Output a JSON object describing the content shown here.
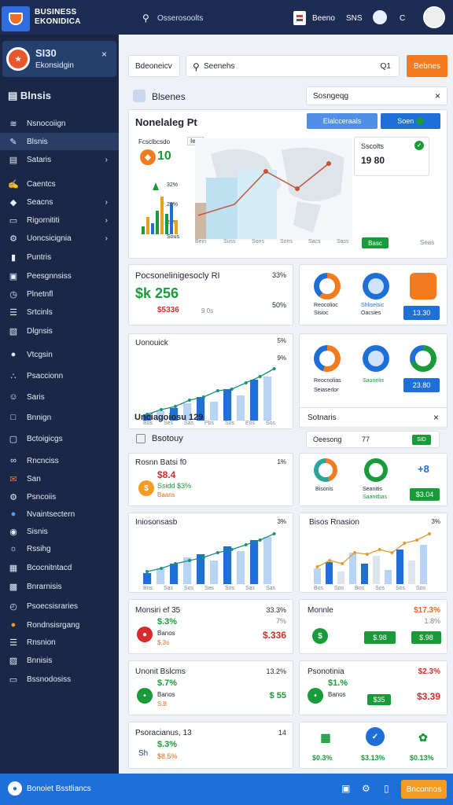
{
  "topbar": {
    "brand_line1": "BUSINESS",
    "brand_line2": "EKONIDICA",
    "search_text": "Osserosoolts",
    "button1": "Beeno",
    "button2": "SNS",
    "icon_c": "C"
  },
  "sidebar": {
    "card_title": "SI30",
    "card_sub": "Ekonsidgin",
    "heading": "Blnsis",
    "items": [
      {
        "label": "Nsnocoiign",
        "icon": "chart-icon"
      },
      {
        "label": "Blsnis",
        "icon": "edit-icon"
      },
      {
        "label": "Sataris",
        "icon": "doc-icon"
      },
      {
        "label": "Caentcs",
        "icon": "pen-icon"
      },
      {
        "label": "Seacns",
        "icon": "shield-icon"
      },
      {
        "label": "Rigornititi",
        "icon": "monitor-icon"
      },
      {
        "label": "Uoncsicignia",
        "icon": "gear-icon"
      },
      {
        "label": "Puntris",
        "icon": "bar-icon"
      },
      {
        "label": "Peesgnnsiss",
        "icon": "image-icon"
      },
      {
        "label": "Plnetnfl",
        "icon": "clock-icon"
      },
      {
        "label": "Srtcinls",
        "icon": "list-icon"
      },
      {
        "label": "Dlgnsis",
        "icon": "doc2-icon"
      },
      {
        "label": "Vtcgsin",
        "icon": "globe-icon"
      },
      {
        "label": "Psaccionn",
        "icon": "stats-icon"
      },
      {
        "label": "Saris",
        "icon": "people-icon"
      },
      {
        "label": "Bnnign",
        "icon": "square-icon"
      },
      {
        "label": "Bctoigicgs",
        "icon": "box-icon"
      },
      {
        "label": "Rncnciss",
        "icon": "link-icon"
      },
      {
        "label": "San",
        "icon": "mail-icon"
      },
      {
        "label": "Psncoiis",
        "icon": "cog-icon"
      },
      {
        "label": "Nvaintsectern",
        "icon": "twitter-icon"
      },
      {
        "label": "Sisnis",
        "icon": "circle-icon"
      },
      {
        "label": "Rssihg",
        "icon": "rss-icon"
      },
      {
        "label": "Bcocnitntacd",
        "icon": "table-icon"
      },
      {
        "label": "Bnrarnisis",
        "icon": "grid-icon"
      },
      {
        "label": "Psoecsisraries",
        "icon": "clock2-icon"
      },
      {
        "label": "Rondnsisrgang",
        "icon": "orange-icon"
      },
      {
        "label": "Rnsnion",
        "icon": "stack-icon"
      },
      {
        "label": "Bnnisis",
        "icon": "sheet-icon"
      },
      {
        "label": "Bssnodosiss",
        "icon": "monitor2-icon"
      }
    ]
  },
  "toolbar": {
    "dropdown": "Bdeoneicv",
    "search_placeholder": "Seenehs",
    "search_icon_text": "Q1",
    "action": "Bebnes"
  },
  "section1": {
    "title": "Blsenes",
    "filter": "Sosngeqg"
  },
  "map_card": {
    "title": "Nonelaleg Pt",
    "dropdown": "Elalcceraals",
    "toggle": "Soen",
    "mini_title": "Fcsclbcsdo",
    "mini_tag": "Ieio",
    "mini_value": "10",
    "axis": [
      "32%",
      "29%",
      "28%"
    ],
    "axis_small": "Sous",
    "popup_title": "Sscolts",
    "popup_value": "19 80",
    "x_labels": [
      "Bein",
      "Suss",
      "Sons",
      "Sons",
      "Sacs",
      "Sass"
    ],
    "btn": "Basc",
    "x_last": "Seas"
  },
  "perf_card": {
    "title": "Pocsonelinigesocly RI",
    "pct": "33%",
    "value": "$k 256",
    "sub": "$5336",
    "sub2": "9 0s",
    "pct2": "50%"
  },
  "donut_card1": {
    "labels": [
      "Reocolioc",
      "Sisioc",
      "Shliselsic",
      "Oacsies"
    ],
    "value": "13.30"
  },
  "line_card1": {
    "title": "Uonouick",
    "pct": "5%",
    "pct2": "9%",
    "x": [
      "Bos",
      "Ses",
      "Sas",
      "Pbs",
      "Sos",
      "Eos",
      "Sos"
    ]
  },
  "donut_card2": {
    "labels": [
      "Reocnolias",
      "Saonelis",
      "Seiaserlor"
    ],
    "value": "23.80"
  },
  "section2": {
    "title": "Unciagoiosu 129",
    "filter_title": "Sotnaris",
    "sub_title": "Bsotouy",
    "toggle_text": "Oeesong",
    "toggle_num": "77",
    "toggle_btn": "SID"
  },
  "row3": {
    "left_title": "Rosnn Batsi f0",
    "left_pct": "1%",
    "left_value": "$8.4",
    "left_sub": "Ssidd $3%",
    "left_sub2": "Baans",
    "right_labels": [
      "Bisonis",
      "Seanitis",
      "Saanitbas"
    ],
    "right_btn": "$3.04",
    "right_num": "+8"
  },
  "row4": {
    "left_title": "Iniosonsasb",
    "left_pct": "3%",
    "left_x": [
      "Bns",
      "Sas",
      "Sos",
      "Ses",
      "Sos",
      "Sas",
      "Sas"
    ],
    "right_title": "Bisos Rnasion",
    "right_pct": "3%",
    "right_x": [
      "Bos",
      "Sos",
      "Bos",
      "Sos",
      "Sos",
      "Sos"
    ]
  },
  "row5": {
    "left_title": "Monsiri ef 35",
    "left_pct": "33.3%",
    "left_val": "$.3%",
    "left_val2": "$.336",
    "left_sub": "Banos",
    "left_sub2": "$.3s",
    "left_pct2": "7%",
    "right_title": "Monnle",
    "right_pct": "$17.3%",
    "right_pct2": "1.8%",
    "right_icon": "$",
    "right_btn1": "$.98",
    "right_btn2": "$.98"
  },
  "row6": {
    "left_title": "Unonit Bslcms",
    "left_pct": "13.2%",
    "left_val": "$.7%",
    "left_val2": "$ 55",
    "left_sub": "Banos",
    "left_sub2": "S.8",
    "right_title": "Psonotinia",
    "right_pct": "$2.3%",
    "right_val": "$1.%",
    "right_val2": "$3.39",
    "right_sub": "Banos",
    "right_btn": "$35"
  },
  "row7": {
    "left_title": "Psoracianus, 13",
    "left_pct": "14",
    "left_val": "$.3%",
    "left_sub": "$8.5%",
    "left_icon": "Sh",
    "right_vals": [
      "$0.3%",
      "$3.13%",
      "$0.13%"
    ]
  },
  "bottom": {
    "text": "Bonoiet Bsstliancs",
    "btn": "Bnconnos"
  },
  "colors": {
    "accent": "#f27b1f",
    "primary": "#1f6fd8",
    "nav": "#1a2746",
    "green": "#1a9b3a"
  }
}
